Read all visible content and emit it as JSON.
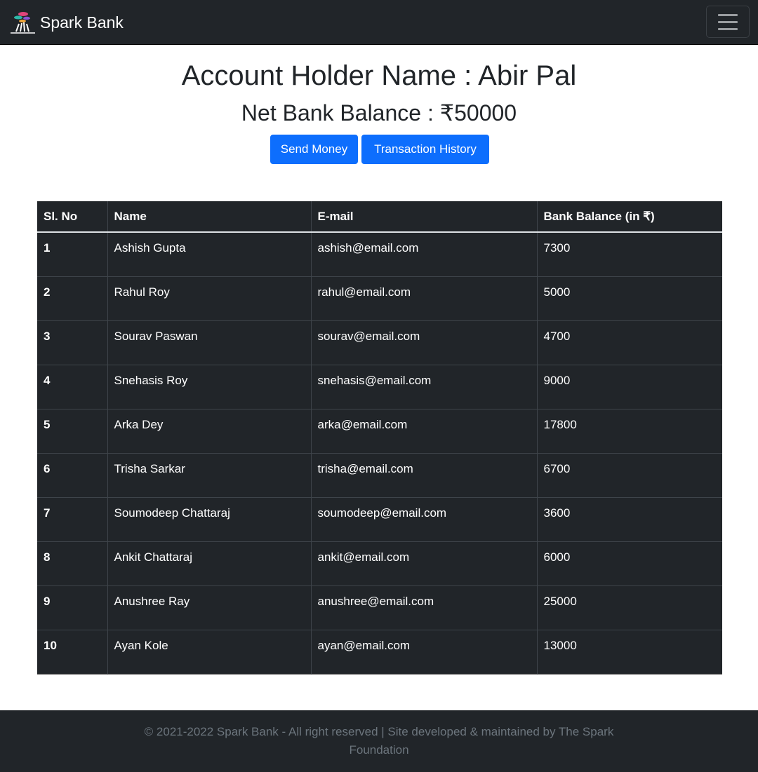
{
  "navbar": {
    "brand_name": "Spark Bank",
    "logo_icon": "bank-tree-logo",
    "toggler_icon": "hamburger-menu-icon"
  },
  "header": {
    "title": "Account Holder Name : Abir Pal",
    "balance": "Net Bank Balance : ₹50000"
  },
  "actions": {
    "send_label": "Send Money",
    "history_label": "Transaction History"
  },
  "table": {
    "columns": [
      "Sl. No",
      "Name",
      "E-mail",
      "Bank Balance (in ₹)"
    ],
    "rows": [
      [
        "1",
        "Ashish Gupta",
        "ashish@email.com",
        "7300"
      ],
      [
        "2",
        "Rahul Roy",
        "rahul@email.com",
        "5000"
      ],
      [
        "3",
        "Sourav Paswan",
        "sourav@email.com",
        "4700"
      ],
      [
        "4",
        "Snehasis Roy",
        "snehasis@email.com",
        "9000"
      ],
      [
        "5",
        "Arka Dey",
        "arka@email.com",
        "17800"
      ],
      [
        "6",
        "Trisha Sarkar",
        "trisha@email.com",
        "6700"
      ],
      [
        "7",
        "Soumodeep Chattaraj",
        "soumodeep@email.com",
        "3600"
      ],
      [
        "8",
        "Ankit Chattaraj",
        "ankit@email.com",
        "6000"
      ],
      [
        "9",
        "Anushree Ray",
        "anushree@email.com",
        "25000"
      ],
      [
        "10",
        "Ayan Kole",
        "ayan@email.com",
        "13000"
      ]
    ]
  },
  "footer": {
    "text": "© 2021-2022 Spark Bank - All right reserved | Site developed & maintained by The Spark Foundation"
  },
  "colors": {
    "dark": "#212529",
    "primary": "#0d6efd",
    "muted": "#6c757d"
  }
}
